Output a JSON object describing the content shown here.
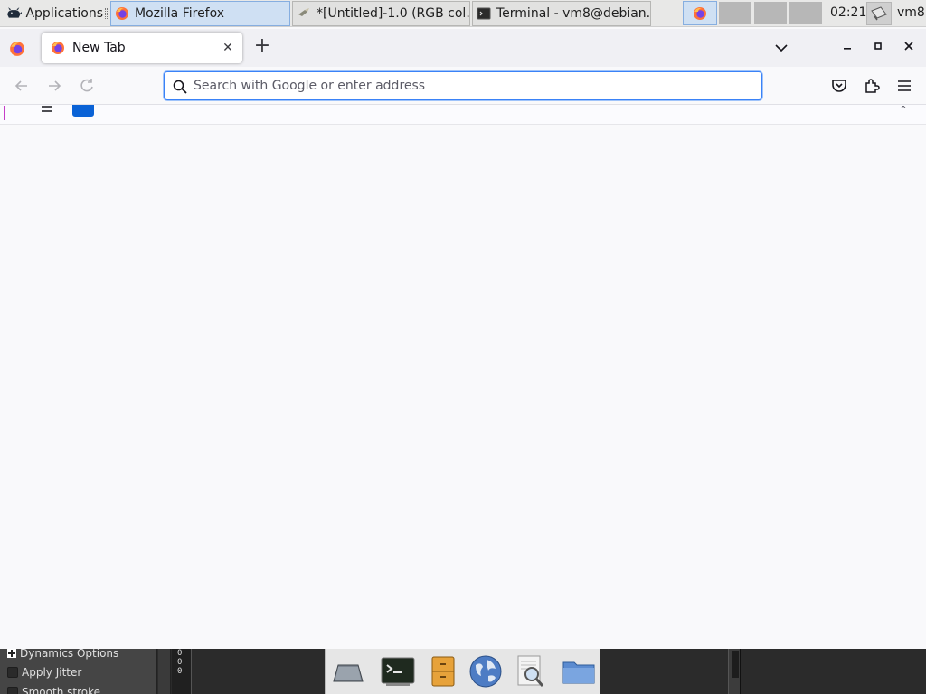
{
  "panel": {
    "applications_label": "Applications",
    "tasks": [
      {
        "label": "Mozilla Firefox",
        "icon": "firefox-icon",
        "active": true
      },
      {
        "label": "*[Untitled]-1.0 (RGB col...",
        "icon": "gimp-icon",
        "active": false
      },
      {
        "label": "Terminal - vm8@debian...",
        "icon": "terminal-icon",
        "active": false
      }
    ],
    "clock": "02:21",
    "user": "vm8"
  },
  "browser": {
    "tab_title": "New Tab",
    "url_placeholder": "Search with Google or enter address",
    "url_value": ""
  },
  "gimp": {
    "option_dynamics": "Dynamics Options",
    "option_jitter": "Apply Jitter",
    "option_smooth": "Smooth stroke",
    "ruler_values": [
      "0",
      "0",
      "0"
    ]
  },
  "dock": {
    "items": [
      "show-desktop-icon",
      "terminal-icon",
      "file-manager-icon",
      "web-browser-icon",
      "app-finder-icon",
      "folder-icon"
    ]
  },
  "colors": {
    "accent": "#3a82f7",
    "active_task": "#cfe0f3",
    "firefox_orange": "#ff7139",
    "firefox_purple": "#7542e5"
  }
}
